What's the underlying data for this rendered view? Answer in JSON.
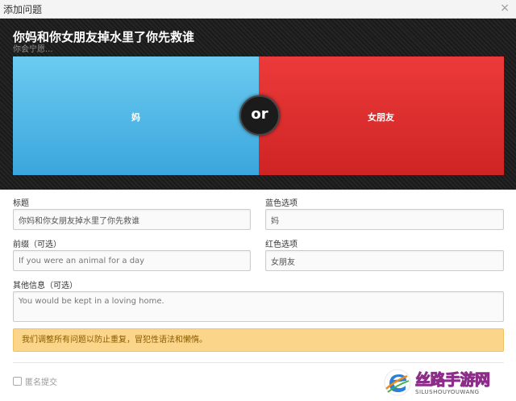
{
  "dialog": {
    "title": "添加问题",
    "close_icon": "close-icon"
  },
  "preview": {
    "question": "你妈和你女朋友掉水里了你先救谁",
    "prefix": "你会宁愿...",
    "blue_label": "妈",
    "red_label": "女朋友",
    "or_label": "or",
    "colors": {
      "blue": "#4fb9e8",
      "red": "#e03030",
      "dark": "#1e1e1e"
    }
  },
  "form": {
    "title_label": "标题",
    "title_value": "你妈和你女朋友掉水里了你先救谁",
    "blue_label": "蓝色选项",
    "blue_value": "妈",
    "prefix_label": "前缀（可选）",
    "prefix_placeholder": "If you were an animal for a day",
    "red_label": "红色选项",
    "red_value": "女朋友",
    "extra_label": "其他信息（可选）",
    "extra_placeholder": "You would be kept in a loving home."
  },
  "notice": {
    "text": "我们调整所有问题以防止重复，冒犯性语法和懒惰。",
    "color": "#fbd589"
  },
  "footer": {
    "anonymous_label": "匿名提交"
  },
  "watermark": {
    "brand": "丝路手游网",
    "sub": "SILUSHOUYOUWANG"
  }
}
